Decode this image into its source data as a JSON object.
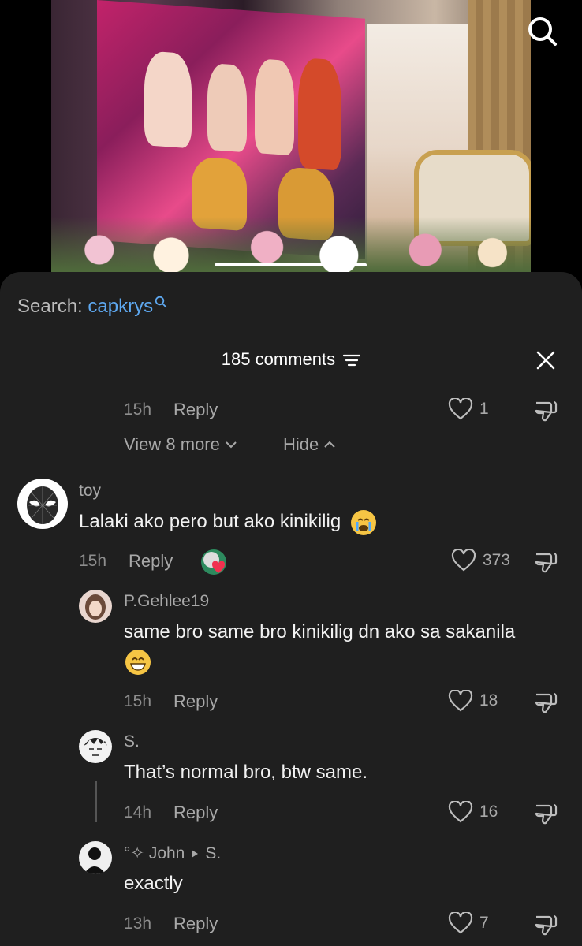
{
  "sheet": {
    "search_prefix": "Search:",
    "search_term": "capkrys",
    "comment_count": "185 comments"
  },
  "prev_reply": {
    "time": "15h",
    "reply": "Reply",
    "likes": "1"
  },
  "thread_controls": {
    "view_more": "View 8 more",
    "hide": "Hide"
  },
  "comment": {
    "user": "toy",
    "text": "Lalaki ako pero but ako kinikilig",
    "time": "15h",
    "reply": "Reply",
    "likes": "373"
  },
  "replies": [
    {
      "user": "P.Gehlee19",
      "text": "same bro same bro kinikilig dn ako sa sakanila",
      "time": "15h",
      "reply": "Reply",
      "likes": "18"
    },
    {
      "user": "S.",
      "text": "That’s normal bro, btw same.",
      "time": "14h",
      "reply": "Reply",
      "likes": "16"
    },
    {
      "user": "°✧ John",
      "reply_to": "S.",
      "text": "exactly",
      "time": "13h",
      "reply": "Reply",
      "likes": "7"
    }
  ],
  "colors": {
    "sheet_bg": "#1f1f1f",
    "link_blue": "#5ea8f0",
    "muted": "#8e8e8e"
  },
  "icons": [
    "search-icon",
    "sort-icon",
    "close-icon",
    "heart-icon",
    "dislike-icon",
    "chevron-down-icon",
    "chevron-up-icon"
  ]
}
